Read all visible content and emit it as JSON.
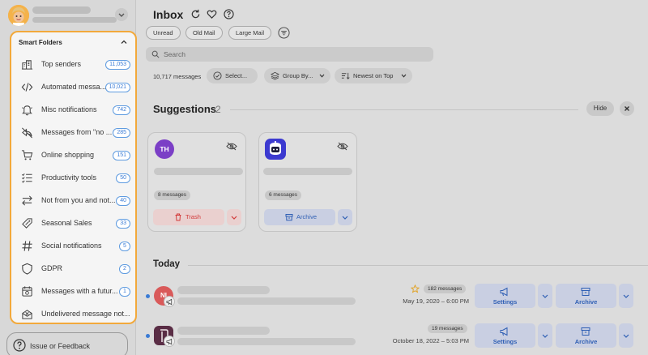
{
  "sidebar": {
    "smart_folders_heading": "Smart Folders",
    "folders": [
      {
        "label": "Top senders",
        "count": "11,053",
        "icon": "buildings-icon"
      },
      {
        "label": "Automated messa...",
        "count": "10,021",
        "icon": "code-icon"
      },
      {
        "label": "Misc notifications",
        "count": "742",
        "icon": "bell-icon"
      },
      {
        "label": "Messages from \"no ...",
        "count": "285",
        "icon": "no-reply-icon"
      },
      {
        "label": "Online shopping",
        "count": "151",
        "icon": "cart-icon"
      },
      {
        "label": "Productivity tools",
        "count": "50",
        "icon": "checklist-icon"
      },
      {
        "label": "Not from you and not...",
        "count": "40",
        "icon": "swap-arrows-icon"
      },
      {
        "label": "Seasonal Sales",
        "count": "33",
        "icon": "tag-icon"
      },
      {
        "label": "Social notifications",
        "count": "5",
        "icon": "hash-icon"
      },
      {
        "label": "GDPR",
        "count": "2",
        "icon": "shield-icon"
      },
      {
        "label": "Messages with a futur...",
        "count": "1",
        "icon": "calendar-icon"
      },
      {
        "label": "Undelivered message not...",
        "count": "",
        "icon": "undelivered-mail-icon"
      }
    ],
    "feedback_label": "Issue or Feedback"
  },
  "main": {
    "title": "Inbox",
    "filter_chips": [
      "Unread",
      "Old Mail",
      "Large Mail"
    ],
    "search_placeholder": "Search",
    "message_count": "10,717 messages",
    "select_label": "Select...",
    "group_by_label": "Group By...",
    "sort_label": "Newest on Top"
  },
  "suggestions": {
    "heading": "Suggestions",
    "count": "2",
    "hide_label": "Hide",
    "cards": [
      {
        "avatar_text": "TH",
        "avatar_color": "#7b3fc6",
        "messages": "8 messages",
        "action": "Trash",
        "action_color": "#d23a3a"
      },
      {
        "avatar_text": "",
        "avatar_color": "#3c3ad0",
        "messages": "6 messages",
        "action": "Archive",
        "action_color": "#2f5fb4"
      }
    ]
  },
  "today": {
    "heading": "Today",
    "rows": [
      {
        "avatar_text": "NI",
        "avatar_color": "#d95a5a",
        "starred": true,
        "count": "182 messages",
        "date": "May 19, 2020 – 6:00 PM",
        "primary_action": "Settings",
        "secondary_action": "Archive"
      },
      {
        "avatar_text": "",
        "avatar_color": "#5a2d45",
        "starred": false,
        "count": "19 messages",
        "date": "October 18, 2022 – 5:03 PM",
        "primary_action": "Settings",
        "secondary_action": "Archive"
      }
    ]
  },
  "colors": {
    "accent": "#3a7bd5",
    "highlight_border": "#f2a93b",
    "danger": "#d23a3a"
  }
}
